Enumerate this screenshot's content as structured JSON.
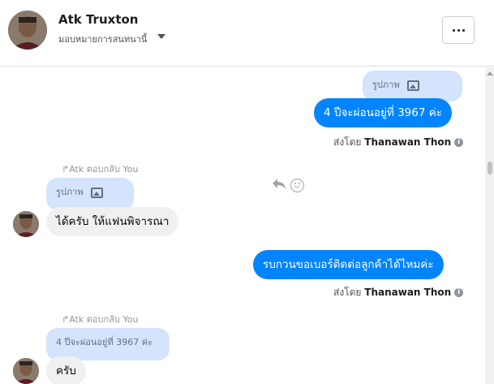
{
  "header": {
    "name": "Atk Truxton",
    "subtitle": "มอบหมายการสนทนานี้"
  },
  "messages": {
    "m1_ghost": "รูปภาพ",
    "m1_text": "4 ปีจะผ่อนอยู่ที่ 3967 ค่ะ",
    "m1_sent_prefix": "ส่งโดย",
    "m1_sent_name": "Thanawan Thon",
    "m2_reply_note": "Atk ตอบกลับ You",
    "m2_ghost": "รูปภาพ",
    "m2_text": "ได้ครับ ให้แฟนพิจารณา",
    "m3_text": "รบกวนขอเบอร์ติดต่อลูกค้าได้ไหมค่ะ",
    "m3_sent_prefix": "ส่งโดย",
    "m3_sent_name": "Thanawan Thon",
    "m4_reply_note": "Atk ตอบกลับ You",
    "m4_ghost": "4 ปีจะผ่อนอยู่ที่ 3967 ค่ะ",
    "m4_text": "ครับ"
  },
  "icons": {
    "info": "i"
  },
  "colors": {
    "outgoing": "#0084ff",
    "incoming": "#f1f0f0",
    "quoted": "#d3e4fc"
  }
}
